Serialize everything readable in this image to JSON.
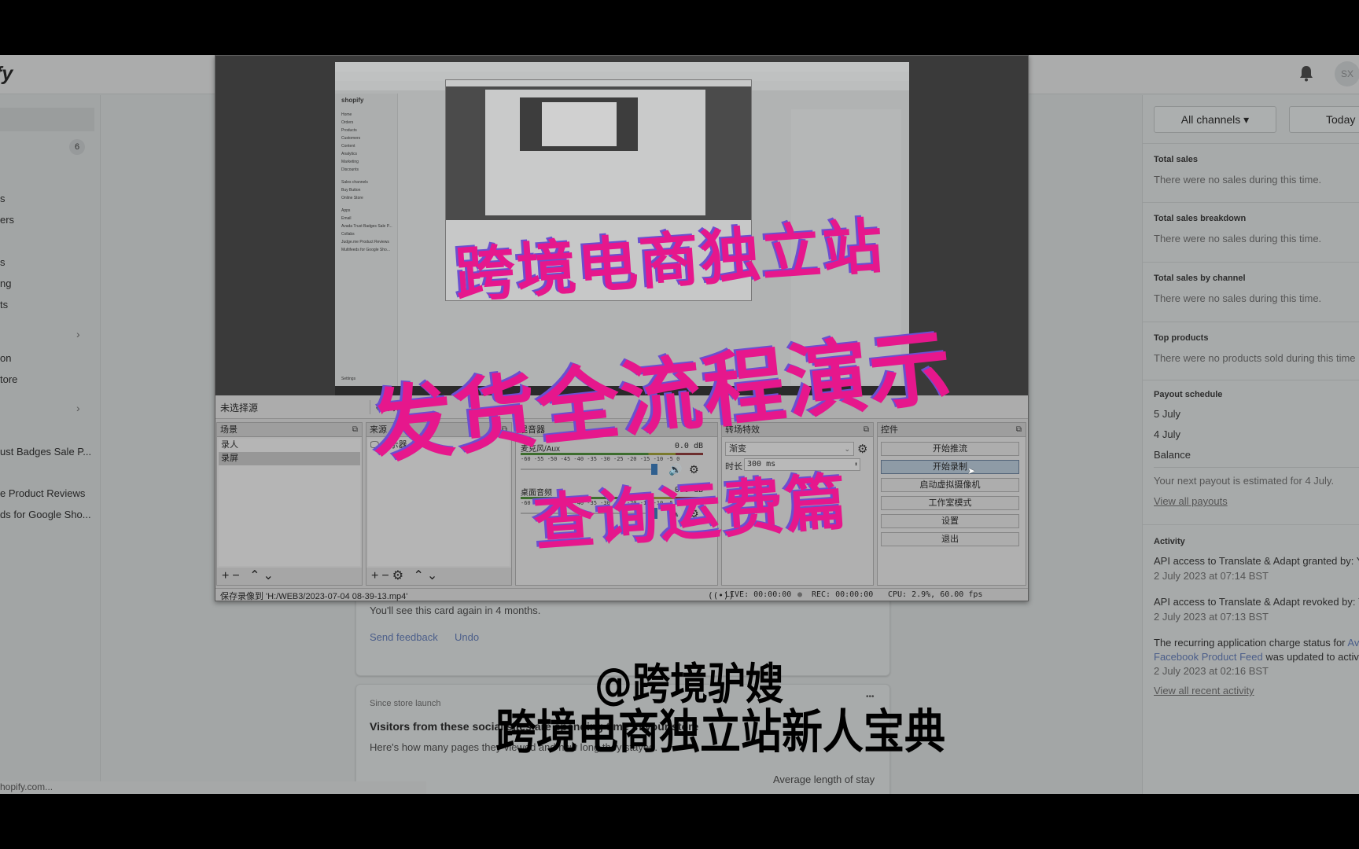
{
  "shopify": {
    "logo_partial": "fy",
    "avatar_initials": "SX",
    "sidebar": {
      "orders_badge": "6",
      "items": [
        {
          "label": "s"
        },
        {
          "label": "ers"
        },
        {
          "label": "s"
        },
        {
          "label": "ng"
        },
        {
          "label": "ts"
        },
        {
          "label": "on"
        },
        {
          "label": "tore"
        },
        {
          "label": "ust Badges Sale P..."
        },
        {
          "label": "e Product Reviews"
        },
        {
          "label": "ds for Google Sho..."
        }
      ]
    },
    "status_url": "hopify.com...",
    "main": {
      "dismiss_card": {
        "message": "You'll see this card again in 4 months.",
        "send_feedback": "Send feedback",
        "undo": "Undo"
      },
      "visitors_card": {
        "eyebrow": "Since store launch",
        "title": "Visitors from these social sites are spending time in your store",
        "subtitle": "Here's how many pages they viewed and how long they stayed.",
        "column_header": "Average length of stay",
        "more_icon": "•••"
      }
    },
    "right_panel": {
      "channel_filter": "All channels ▾",
      "date_filter": "Today",
      "sections": [
        {
          "title": "Total sales",
          "text": "There were no sales during this time."
        },
        {
          "title": "Total sales breakdown",
          "text": "There were no sales during this time."
        },
        {
          "title": "Total sales by channel",
          "text": "There were no sales during this time."
        },
        {
          "title": "Top products",
          "text": "There were no products sold during this time"
        }
      ],
      "payout": {
        "title": "Payout schedule",
        "rows": [
          "5 July",
          "4 July",
          "Balance"
        ],
        "note": "Your next payout is estimated for 4 July.",
        "link": "View all payouts"
      },
      "activity": {
        "title": "Activity",
        "items": [
          {
            "text": "API access to Translate & Adapt granted by: Y",
            "time": "2 July 2023 at 07:14 BST"
          },
          {
            "text": "API access to Translate & Adapt revoked by: Y",
            "time": "2 July 2023 at 07:13 BST"
          },
          {
            "text_a": "The recurring application charge status for ",
            "link_a": "Av",
            "link_b": "Facebook Product Feed",
            "text_b": " was updated to active",
            "time": "2 July 2023 at 02:16 BST"
          }
        ],
        "link": "View all recent activity"
      }
    }
  },
  "obs": {
    "source_bar": {
      "no_source": "未选择源",
      "properties": "属性"
    },
    "scenes": {
      "title": "场景",
      "items": [
        {
          "label": "录人",
          "selected": false
        },
        {
          "label": "录屏",
          "selected": true
        }
      ]
    },
    "sources": {
      "title": "来源",
      "items": [
        {
          "label": "显示器"
        }
      ]
    },
    "mixer": {
      "title": "混音器",
      "channels": [
        {
          "name": "麦克风/Aux",
          "db": "0.0 dB"
        },
        {
          "name": "桌面音频",
          "db": "0.0 dB"
        }
      ],
      "scale": "-60 -55 -50 -45 -40 -35 -30 -25 -20 -15 -10 -5 0"
    },
    "transitions": {
      "title": "转场特效",
      "selected": "渐变",
      "duration_label": "时长",
      "duration_value": "300 ms"
    },
    "controls": {
      "title": "控件",
      "buttons": [
        {
          "label": "开始推流",
          "active": false
        },
        {
          "label": "开始录制",
          "active": true
        },
        {
          "label": "启动虚拟摄像机",
          "active": false
        },
        {
          "label": "工作室模式",
          "active": false
        },
        {
          "label": "设置",
          "active": false
        },
        {
          "label": "退出",
          "active": false
        }
      ]
    },
    "status": {
      "save_path": "保存录像到 'H:/WEB3/2023-07-04 08-39-13.mp4'",
      "live": "LIVE: 00:00:00",
      "rec": "REC: 00:00:00",
      "cpu": "CPU: 2.9%, 60.00 fps"
    },
    "nested_preview": {
      "logo": "shopify",
      "sidebar_items": [
        "Home",
        "Orders",
        "Products",
        "Customers",
        "Content",
        "Analytics",
        "Marketing",
        "Discounts",
        "Sales channels",
        "Buy Button",
        "Online Store",
        "Apps",
        "Email",
        "Avada Trust Badges Sale P...",
        "Collabs",
        "Judge.me Product Reviews",
        "Multifeeds for Google Sho...",
        "Settings"
      ]
    }
  },
  "overlay": {
    "line1": "跨境电商独立站",
    "line2": "发货全流程演示",
    "line3": "查询运费篇"
  },
  "caption": {
    "line1": "@跨境驴嫂",
    "line2": "跨境电商独立站新人宝典"
  },
  "colors": {
    "overlay_pink": "#e6178c",
    "overlay_shadow": "#6b4fd0",
    "record_active": "#8e9ba6"
  }
}
